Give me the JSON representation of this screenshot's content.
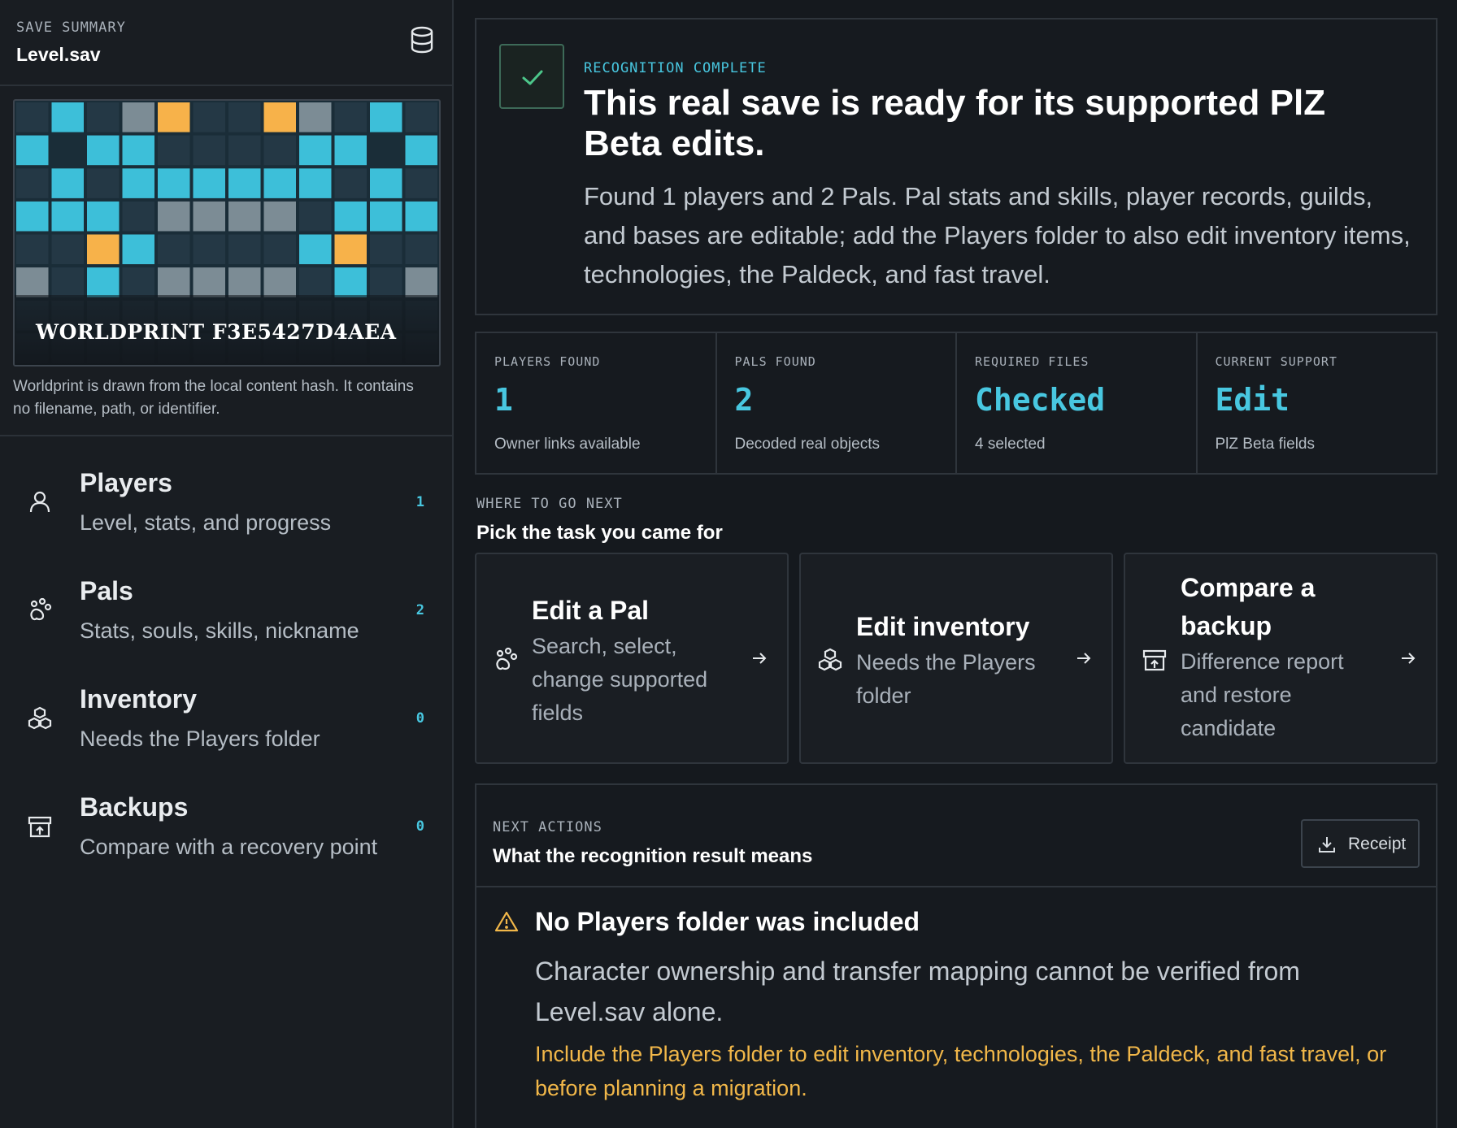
{
  "sidebar": {
    "eyebrow": "SAVE SUMMARY",
    "file_name": "Level.sav",
    "icons": {
      "header": "database-icon"
    },
    "worldprint": {
      "label": "WORLDPRINT F3E5427D4AEA",
      "caption": "Worldprint is drawn from the local content hash. It contains no filename, path, or identifier.",
      "colors": {
        "background": "#1a2d38",
        "cyan": "#3dbfd9",
        "orange": "#f7b24a",
        "gray": "#7c8c95",
        "dark": "#243845"
      }
    },
    "nav": [
      {
        "title": "Players",
        "subtitle": "Level, stats, and progress",
        "count": "1",
        "icon": "user-icon"
      },
      {
        "title": "Pals",
        "subtitle": "Stats, souls, skills, nickname",
        "count": "2",
        "icon": "paw-icon"
      },
      {
        "title": "Inventory",
        "subtitle": "Needs the Players folder",
        "count": "0",
        "icon": "boxes-icon"
      },
      {
        "title": "Backups",
        "subtitle": "Compare with a recovery point",
        "count": "0",
        "icon": "archive-icon"
      }
    ]
  },
  "hero": {
    "eyebrow": "RECOGNITION COMPLETE",
    "title": "This real save is ready for its supported PlZ Beta edits.",
    "body": "Found 1 players and 2 Pals. Pal stats and skills, player records, guilds, and bases are editable; add the Players folder to also edit inventory items, technologies, the Paldeck, and fast travel.",
    "icon": "check-icon"
  },
  "stats": [
    {
      "label": "PLAYERS FOUND",
      "value": "1",
      "note": "Owner links available"
    },
    {
      "label": "PALS FOUND",
      "value": "2",
      "note": "Decoded real objects"
    },
    {
      "label": "REQUIRED FILES",
      "value": "Checked",
      "note": "4 selected"
    },
    {
      "label": "CURRENT SUPPORT",
      "value": "Edit",
      "note": "PlZ Beta fields"
    }
  ],
  "next": {
    "eyebrow": "WHERE TO GO NEXT",
    "title": "Pick the task you came for",
    "tasks": [
      {
        "title": "Edit a Pal",
        "subtitle": "Search, select, change supported fields",
        "icon": "paw-icon"
      },
      {
        "title": "Edit inventory",
        "subtitle": "Needs the Players folder",
        "icon": "boxes-icon"
      },
      {
        "title": "Compare a backup",
        "subtitle": "Difference report and restore candidate",
        "icon": "archive-icon"
      }
    ]
  },
  "actions": {
    "eyebrow": "NEXT ACTIONS",
    "title": "What the recognition result means",
    "receipt_label": "Receipt",
    "warning": {
      "title": "No Players folder was included",
      "body": "Character ownership and transfer mapping cannot be verified from Level.sav alone.",
      "hint": "Include the Players folder to edit inventory, technologies, the Paldeck, and fast travel, or before planning a migration."
    }
  },
  "colors": {
    "accent": "#48c7e0",
    "warning": "#f1b749",
    "success": "#4cc68a",
    "background": "#15191e"
  }
}
